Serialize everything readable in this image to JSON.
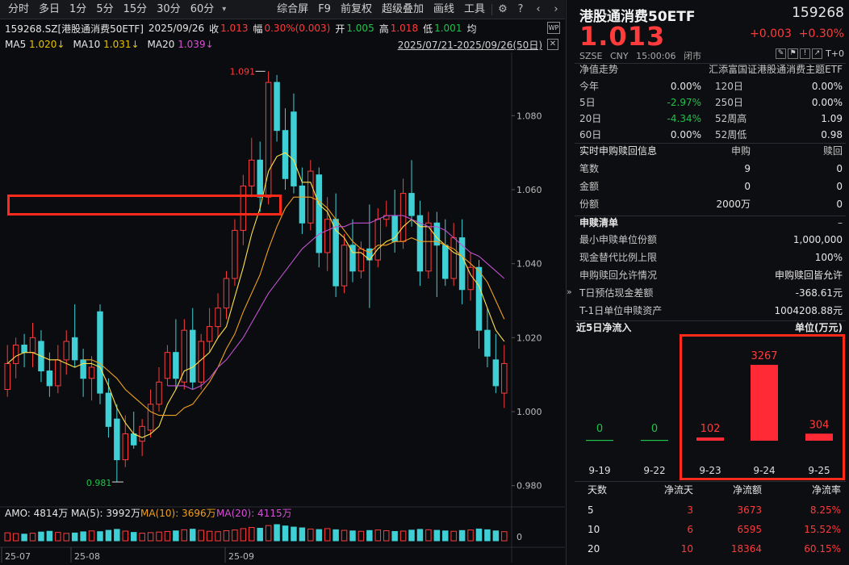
{
  "toolbar": {
    "periods": [
      "分时",
      "多日",
      "1分",
      "5分",
      "15分",
      "30分",
      "60分"
    ],
    "tools": [
      "综合屏",
      "F9",
      "前复权",
      "超级叠加",
      "画线",
      "工具"
    ]
  },
  "info": {
    "symbol": "159268.SZ[港股通消费50ETF]",
    "date": "2025/09/26",
    "close_label": "收",
    "close": "1.013",
    "amp_label": "幅",
    "amp": "0.30%(0.003)",
    "open_label": "开",
    "open": "1.005",
    "high_label": "高",
    "high": "1.018",
    "low_label": "低",
    "low": "1.001",
    "avg_label": "均"
  },
  "ma": {
    "ma5_label": "MA5",
    "ma5": "1.020↓",
    "ma10_label": "MA10",
    "ma10": "1.031↓",
    "ma20_label": "MA20",
    "ma20": "1.039↓",
    "range": "2025/07/21-2025/09/26(50日)"
  },
  "volume_info": {
    "amo": "AMO: 4814万",
    "vma5": "MA(5): 3992万",
    "vma10": "MA(10): 3696万",
    "vma20": "MA(20): 4115万",
    "zero": "0"
  },
  "colors": {
    "up": "#ff3b3b",
    "down": "#3fd0d6",
    "ma5": "#ffe14d",
    "ma10": "#f0a020",
    "ma20": "#c050d0",
    "highlight": "#ff2a1a"
  },
  "chart_data": {
    "type": "candlestick",
    "ylim": [
      0.976,
      1.096
    ],
    "yticks": [
      "1.080",
      "1.060",
      "1.040",
      "1.020",
      "1.000",
      "0.980"
    ],
    "ytick_values": [
      1.08,
      1.06,
      1.04,
      1.02,
      1.0,
      0.98
    ],
    "xticks": [
      "25-07",
      "25-08",
      "25-09"
    ],
    "annotations": {
      "high": "1.091",
      "low": "0.981"
    },
    "candles": [
      {
        "o": 1.006,
        "h": 1.018,
        "l": 1.004,
        "c": 1.013
      },
      {
        "o": 1.013,
        "h": 1.02,
        "l": 1.009,
        "c": 1.018
      },
      {
        "o": 1.018,
        "h": 1.021,
        "l": 1.012,
        "c": 1.016
      },
      {
        "o": 1.016,
        "h": 1.024,
        "l": 1.012,
        "c": 1.02
      },
      {
        "o": 1.019,
        "h": 1.022,
        "l": 1.008,
        "c": 1.011
      },
      {
        "o": 1.011,
        "h": 1.016,
        "l": 1.004,
        "c": 1.007
      },
      {
        "o": 1.007,
        "h": 1.018,
        "l": 1.005,
        "c": 1.014
      },
      {
        "o": 1.014,
        "h": 1.022,
        "l": 1.01,
        "c": 1.019
      },
      {
        "o": 1.02,
        "h": 1.029,
        "l": 1.012,
        "c": 1.014
      },
      {
        "o": 1.014,
        "h": 1.017,
        "l": 1.004,
        "c": 1.009
      },
      {
        "o": 1.009,
        "h": 1.015,
        "l": 1.003,
        "c": 1.012
      },
      {
        "o": 1.027,
        "h": 1.029,
        "l": 1.002,
        "c": 1.005
      },
      {
        "o": 1.005,
        "h": 1.009,
        "l": 0.993,
        "c": 0.996
      },
      {
        "o": 0.998,
        "h": 1.002,
        "l": 0.981,
        "c": 0.987
      },
      {
        "o": 0.987,
        "h": 0.999,
        "l": 0.985,
        "c": 0.994
      },
      {
        "o": 0.994,
        "h": 1.0,
        "l": 0.99,
        "c": 0.991
      },
      {
        "o": 0.992,
        "h": 0.998,
        "l": 0.988,
        "c": 0.996
      },
      {
        "o": 0.995,
        "h": 1.006,
        "l": 0.993,
        "c": 1.002
      },
      {
        "o": 1.002,
        "h": 1.012,
        "l": 1.0,
        "c": 1.008
      },
      {
        "o": 1.009,
        "h": 1.018,
        "l": 1.007,
        "c": 1.016
      },
      {
        "o": 1.016,
        "h": 1.025,
        "l": 1.006,
        "c": 1.009
      },
      {
        "o": 1.008,
        "h": 1.025,
        "l": 1.006,
        "c": 1.022
      },
      {
        "o": 1.022,
        "h": 1.028,
        "l": 1.006,
        "c": 1.008
      },
      {
        "o": 1.008,
        "h": 1.021,
        "l": 1.006,
        "c": 1.019
      },
      {
        "o": 1.019,
        "h": 1.028,
        "l": 1.016,
        "c": 1.023
      },
      {
        "o": 1.023,
        "h": 1.032,
        "l": 1.02,
        "c": 1.028
      },
      {
        "o": 1.028,
        "h": 1.038,
        "l": 1.025,
        "c": 1.036
      },
      {
        "o": 1.036,
        "h": 1.052,
        "l": 1.034,
        "c": 1.049
      },
      {
        "o": 1.049,
        "h": 1.064,
        "l": 1.045,
        "c": 1.061
      },
      {
        "o": 1.061,
        "h": 1.074,
        "l": 1.058,
        "c": 1.068
      },
      {
        "o": 1.068,
        "h": 1.073,
        "l": 1.054,
        "c": 1.058
      },
      {
        "o": 1.058,
        "h": 1.092,
        "l": 1.056,
        "c": 1.089
      },
      {
        "o": 1.089,
        "h": 1.091,
        "l": 1.073,
        "c": 1.076
      },
      {
        "o": 1.076,
        "h": 1.082,
        "l": 1.06,
        "c": 1.063
      },
      {
        "o": 1.081,
        "h": 1.086,
        "l": 1.059,
        "c": 1.061
      },
      {
        "o": 1.061,
        "h": 1.066,
        "l": 1.048,
        "c": 1.051
      },
      {
        "o": 1.051,
        "h": 1.068,
        "l": 1.049,
        "c": 1.065
      },
      {
        "o": 1.064,
        "h": 1.066,
        "l": 1.039,
        "c": 1.043
      },
      {
        "o": 1.043,
        "h": 1.058,
        "l": 1.038,
        "c": 1.052
      },
      {
        "o": 1.052,
        "h": 1.059,
        "l": 1.031,
        "c": 1.034
      },
      {
        "o": 1.034,
        "h": 1.048,
        "l": 1.032,
        "c": 1.045
      },
      {
        "o": 1.045,
        "h": 1.052,
        "l": 1.035,
        "c": 1.038
      },
      {
        "o": 1.038,
        "h": 1.046,
        "l": 1.036,
        "c": 1.044
      },
      {
        "o": 1.044,
        "h": 1.056,
        "l": 1.028,
        "c": 1.041
      },
      {
        "o": 1.041,
        "h": 1.055,
        "l": 1.039,
        "c": 1.052
      },
      {
        "o": 1.052,
        "h": 1.057,
        "l": 1.05,
        "c": 1.053
      },
      {
        "o": 1.053,
        "h": 1.06,
        "l": 1.043,
        "c": 1.046
      },
      {
        "o": 1.046,
        "h": 1.063,
        "l": 1.044,
        "c": 1.059
      },
      {
        "o": 1.059,
        "h": 1.068,
        "l": 1.05,
        "c": 1.053
      },
      {
        "o": 1.053,
        "h": 1.057,
        "l": 1.034,
        "c": 1.038
      },
      {
        "o": 1.038,
        "h": 1.054,
        "l": 1.036,
        "c": 1.051
      },
      {
        "o": 1.051,
        "h": 1.054,
        "l": 1.031,
        "c": 1.045
      },
      {
        "o": 1.045,
        "h": 1.052,
        "l": 1.034,
        "c": 1.036
      },
      {
        "o": 1.036,
        "h": 1.051,
        "l": 1.034,
        "c": 1.047
      },
      {
        "o": 1.047,
        "h": 1.052,
        "l": 1.029,
        "c": 1.033
      },
      {
        "o": 1.033,
        "h": 1.043,
        "l": 1.03,
        "c": 1.039
      },
      {
        "o": 1.039,
        "h": 1.041,
        "l": 1.017,
        "c": 1.022
      },
      {
        "o": 1.022,
        "h": 1.028,
        "l": 1.012,
        "c": 1.015
      },
      {
        "o": 1.014,
        "h": 1.021,
        "l": 1.005,
        "c": 1.007
      },
      {
        "o": 1.005,
        "h": 1.018,
        "l": 1.001,
        "c": 1.013
      }
    ],
    "ma5": [
      1.013,
      1.015,
      1.016,
      1.016,
      1.015,
      1.014,
      1.014,
      1.013,
      1.012,
      1.013,
      1.013,
      1.012,
      1.007,
      1.001,
      0.997,
      0.994,
      0.993,
      0.994,
      0.996,
      1.002,
      1.006,
      1.011,
      1.012,
      1.014,
      1.016,
      1.02,
      1.023,
      1.031,
      1.039,
      1.048,
      1.055,
      1.065,
      1.069,
      1.07,
      1.068,
      1.062,
      1.062,
      1.056,
      1.054,
      1.049,
      1.047,
      1.043,
      1.043,
      1.041,
      1.044,
      1.046,
      1.047,
      1.05,
      1.052,
      1.05,
      1.05,
      1.047,
      1.045,
      1.043,
      1.042,
      1.037,
      1.034,
      1.028,
      1.022,
      1.019
    ],
    "ma10": [
      null,
      null,
      null,
      null,
      null,
      null,
      null,
      null,
      null,
      1.014,
      1.014,
      1.013,
      1.011,
      1.009,
      1.006,
      1.004,
      1.002,
      1.0,
      0.999,
      0.999,
      0.999,
      1.001,
      1.002,
      1.005,
      1.008,
      1.012,
      1.017,
      1.021,
      1.027,
      1.032,
      1.037,
      1.044,
      1.05,
      1.055,
      1.058,
      1.058,
      1.058,
      1.057,
      1.055,
      1.052,
      1.049,
      1.046,
      1.044,
      1.043,
      1.045,
      1.045,
      1.046,
      1.046,
      1.047,
      1.046,
      1.046,
      1.046,
      1.045,
      1.044,
      1.042,
      1.04,
      1.038,
      1.035,
      1.03,
      1.025
    ],
    "ma20": [
      null,
      null,
      null,
      null,
      null,
      null,
      null,
      null,
      null,
      null,
      null,
      null,
      null,
      null,
      null,
      null,
      null,
      null,
      null,
      1.007,
      1.007,
      1.007,
      1.006,
      1.007,
      1.009,
      1.012,
      1.014,
      1.017,
      1.02,
      1.024,
      1.028,
      1.032,
      1.035,
      1.038,
      1.041,
      1.044,
      1.046,
      1.048,
      1.049,
      1.05,
      1.05,
      1.051,
      1.051,
      1.051,
      1.052,
      1.053,
      1.053,
      1.053,
      1.052,
      1.051,
      1.05,
      1.05,
      1.049,
      1.047,
      1.045,
      1.043,
      1.042,
      1.04,
      1.038,
      1.036
    ],
    "volume": [
      42,
      38,
      35,
      40,
      46,
      50,
      44,
      39,
      41,
      47,
      52,
      48,
      55,
      60,
      51,
      44,
      40,
      43,
      46,
      49,
      52,
      58,
      61,
      55,
      50,
      48,
      53,
      57,
      64,
      70,
      66,
      80,
      85,
      78,
      72,
      68,
      62,
      59,
      64,
      58,
      55,
      52,
      50,
      54,
      57,
      53,
      49,
      51,
      56,
      60,
      58,
      55,
      52,
      50,
      54,
      57,
      62,
      58,
      52,
      48
    ]
  },
  "panel": {
    "name": "港股通消费50ETF",
    "code": "159268",
    "price": "1.013",
    "change": "+0.003",
    "change_pct": "+0.30%",
    "exchange": "SZSE",
    "currency": "CNY",
    "time": "15:00:06",
    "status": "闭市",
    "t0": "T+0",
    "nav": {
      "title": "净值走势",
      "fund": "汇添富国证港股通消费主题ETF"
    },
    "perf": [
      {
        "l1": "今年",
        "v1": "0.00%",
        "c1": "white",
        "l2": "120日",
        "v2": "0.00%"
      },
      {
        "l1": "5日",
        "v1": "-2.97%",
        "c1": "green",
        "l2": "250日",
        "v2": "0.00%"
      },
      {
        "l1": "20日",
        "v1": "-4.34%",
        "c1": "green",
        "l2": "52周高",
        "v2": "1.09"
      },
      {
        "l1": "60日",
        "v1": "0.00%",
        "c1": "white",
        "l2": "52周低",
        "v2": "0.98"
      }
    ],
    "realtime": {
      "title": "实时申购赎回信息",
      "col_sub": "申购",
      "col_red": "赎回",
      "rows": [
        {
          "label": "笔数",
          "sub": "9",
          "red": "0"
        },
        {
          "label": "金额",
          "sub": "0",
          "red": "0"
        },
        {
          "label": "份额",
          "sub": "2000万",
          "red": "0"
        }
      ]
    },
    "redeem_list": {
      "title": "申赎清单",
      "toggle": "–",
      "rows": [
        {
          "label": "最小申赎单位份额",
          "value": "1,000,000"
        },
        {
          "label": "现金替代比例上限",
          "value": "100%"
        },
        {
          "label": "申购赎回允许情况",
          "value": "申购赎回皆允许"
        },
        {
          "label": "T日预估现金差额",
          "value": "-368.61元"
        },
        {
          "label": "T-1日单位申赎资产",
          "value": "1004208.88元"
        }
      ]
    },
    "flow": {
      "title": "近5日净流入",
      "unit": "单位(万元)",
      "days": [
        "9-19",
        "9-22",
        "9-23",
        "9-24",
        "9-25"
      ],
      "values": [
        0,
        0,
        102,
        3267,
        304
      ],
      "labels": [
        "0",
        "0",
        "102",
        "3267",
        "304"
      ]
    },
    "summary": {
      "headers": [
        "天数",
        "净流天",
        "净流额",
        "净流率"
      ],
      "rows": [
        {
          "days": "5",
          "flow_days": "3",
          "amount": "3673",
          "rate": "8.25%"
        },
        {
          "days": "10",
          "flow_days": "6",
          "amount": "6595",
          "rate": "15.52%"
        },
        {
          "days": "20",
          "flow_days": "10",
          "amount": "18364",
          "rate": "60.15%"
        }
      ]
    }
  }
}
